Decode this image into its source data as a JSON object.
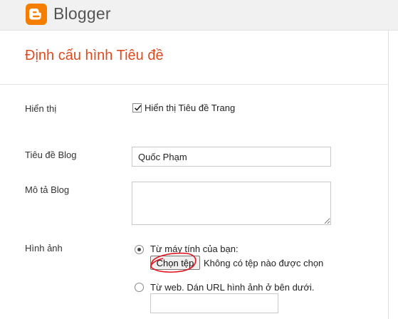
{
  "app": {
    "brand": "Blogger",
    "logo_icon": "blogger-logo-icon",
    "accent_color": "#f57d00"
  },
  "page": {
    "title": "Định cấu hình Tiêu đề",
    "title_color": "#dd4b1e"
  },
  "form": {
    "display": {
      "label": "Hiển thị",
      "checkbox_label": "Hiển thị Tiêu đề Trang",
      "checked": true
    },
    "blog_title": {
      "label": "Tiêu đề Blog",
      "value": "Quốc Phạm"
    },
    "blog_description": {
      "label": "Mô tả Blog",
      "value": ""
    },
    "image": {
      "label": "Hình ảnh",
      "from_computer_label": "Từ máy tính của bạn:",
      "choose_file_label": "Chọn tệp",
      "no_file_text": "Không có tệp nào được chọn",
      "from_web_label": "Từ web. Dán URL hình ảnh ở bên dưới.",
      "url_value": "",
      "selected_option": "from_computer"
    }
  }
}
